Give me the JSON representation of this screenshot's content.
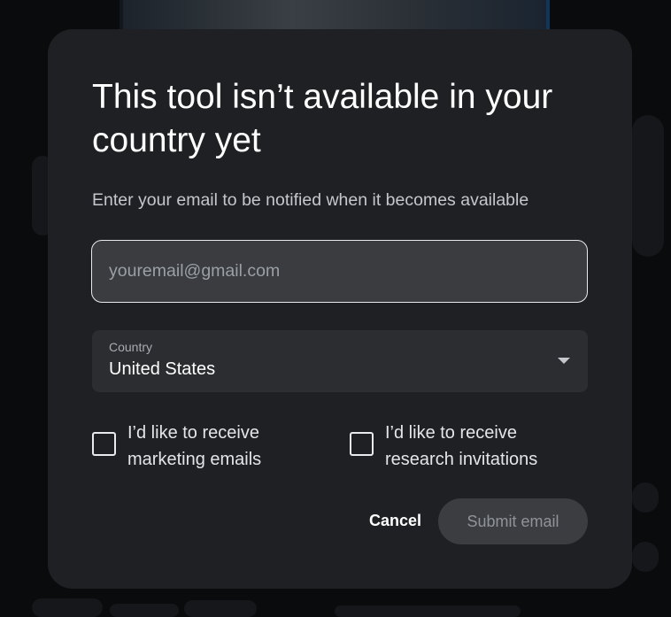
{
  "dialog": {
    "title": "This tool isn’t available in your country yet",
    "subtitle": "Enter your email to be notified when it becomes available",
    "email": {
      "value": "",
      "placeholder": "youremail@gmail.com"
    },
    "country": {
      "label": "Country",
      "selected": "United States"
    },
    "checkboxes": [
      {
        "label": "I’d like to receive marketing emails",
        "checked": false
      },
      {
        "label": "I’d like to receive research invitations",
        "checked": false
      }
    ],
    "actions": {
      "cancel_label": "Cancel",
      "submit_label": "Submit email"
    }
  },
  "colors": {
    "dialog_background": "#1f2023",
    "input_background": "#3a3c40",
    "select_background": "#2b2d31",
    "submit_disabled_background": "#3b3d41",
    "text_primary": "#ffffff",
    "text_secondary": "#c4c7cc"
  }
}
